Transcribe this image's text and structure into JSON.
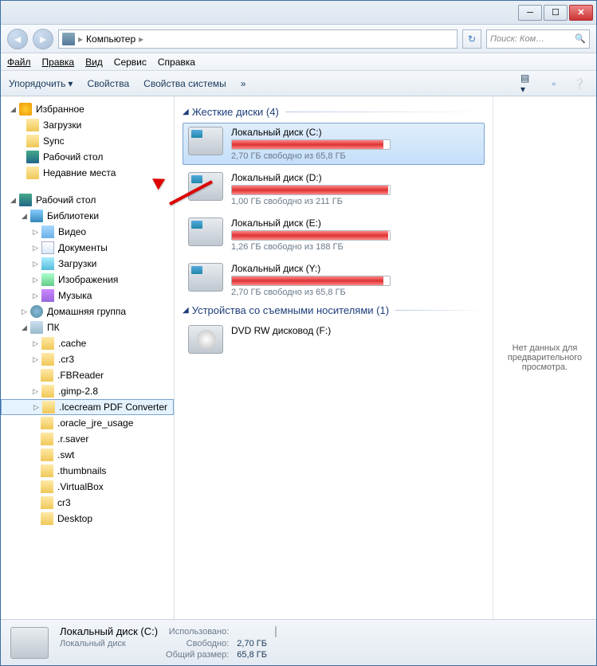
{
  "address": {
    "location": "Компьютер",
    "sep": "▸"
  },
  "search": {
    "placeholder": "Поиск: Ком…"
  },
  "menu": {
    "file": "Файл",
    "edit": "Правка",
    "view": "Вид",
    "tools": "Сервис",
    "help": "Справка"
  },
  "toolbar": {
    "organize": "Упорядочить",
    "properties": "Свойства",
    "sysprops": "Свойства системы",
    "more": "»"
  },
  "tree": {
    "favorites": "Избранное",
    "downloads": "Загрузки",
    "sync": "Sync",
    "desktop_fav": "Рабочий стол",
    "recent": "Недавние места",
    "desktop": "Рабочий стол",
    "libraries": "Библиотеки",
    "videos": "Видео",
    "documents": "Документы",
    "downloads2": "Загрузки",
    "pictures": "Изображения",
    "music": "Музыка",
    "homegroup": "Домашняя группа",
    "pc": "ПК",
    "cache": ".cache",
    "cr3": ".cr3",
    "fbreader": ".FBReader",
    "gimp": ".gimp-2.8",
    "icecream": ".Icecream PDF Converter",
    "oracle": ".oracle_jre_usage",
    "rsaver": ".r.saver",
    "swt": ".swt",
    "thumbnails": ".thumbnails",
    "virtualbox": ".VirtualBox",
    "cr3b": "cr3",
    "desktop_f": "Desktop"
  },
  "groups": {
    "hdd": "Жесткие диски (4)",
    "removable": "Устройства со съемными носителями (1)"
  },
  "drives": [
    {
      "name": "Локальный диск (C:)",
      "free": "2,70 ГБ свободно из 65,8 ГБ",
      "pct": 96,
      "selected": true
    },
    {
      "name": "Локальный диск (D:)",
      "free": "1,00 ГБ свободно из 211 ГБ",
      "pct": 99,
      "selected": false
    },
    {
      "name": "Локальный диск (E:)",
      "free": "1,26 ГБ свободно из 188 ГБ",
      "pct": 99,
      "selected": false
    },
    {
      "name": "Локальный диск (Y:)",
      "free": "2,70 ГБ свободно из 65,8 ГБ",
      "pct": 96,
      "selected": false
    }
  ],
  "dvd": {
    "name": "DVD RW дисковод (F:)"
  },
  "preview": {
    "text": "Нет данных для предварительного просмотра."
  },
  "status": {
    "title": "Локальный диск (C:)",
    "sub": "Локальный диск",
    "used_lbl": "Использовано:",
    "free_lbl": "Свободно:",
    "free_val": "2,70 ГБ",
    "total_lbl": "Общий размер:",
    "total_val": "65,8 ГБ",
    "pct": 96
  }
}
